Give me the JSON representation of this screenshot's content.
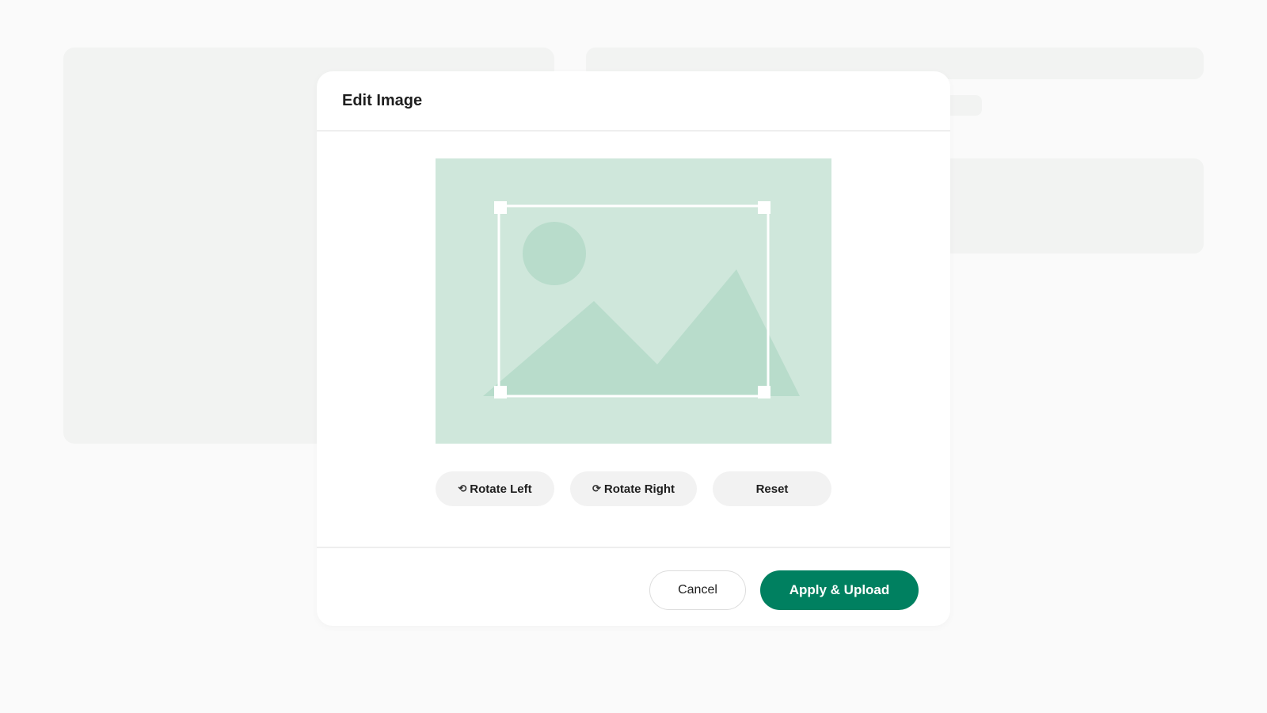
{
  "modal": {
    "title": "Edit Image"
  },
  "editor": {
    "placeholder_icon": "image-placeholder-icon",
    "colors": {
      "canvas": "#cfe7db",
      "shapes": "#b8dccb",
      "crop_frame": "#ffffff"
    }
  },
  "tools": {
    "rotate_left": {
      "icon": "rotate-left-icon",
      "label": "Rotate Left"
    },
    "rotate_right": {
      "icon": "rotate-right-icon",
      "label": "Rotate Right"
    },
    "reset": {
      "label": "Reset"
    }
  },
  "footer": {
    "cancel_label": "Cancel",
    "apply_label": "Apply & Upload"
  },
  "colors": {
    "accent": "#008060",
    "background": "#fafafa",
    "skeleton": "#f2f3f2"
  }
}
